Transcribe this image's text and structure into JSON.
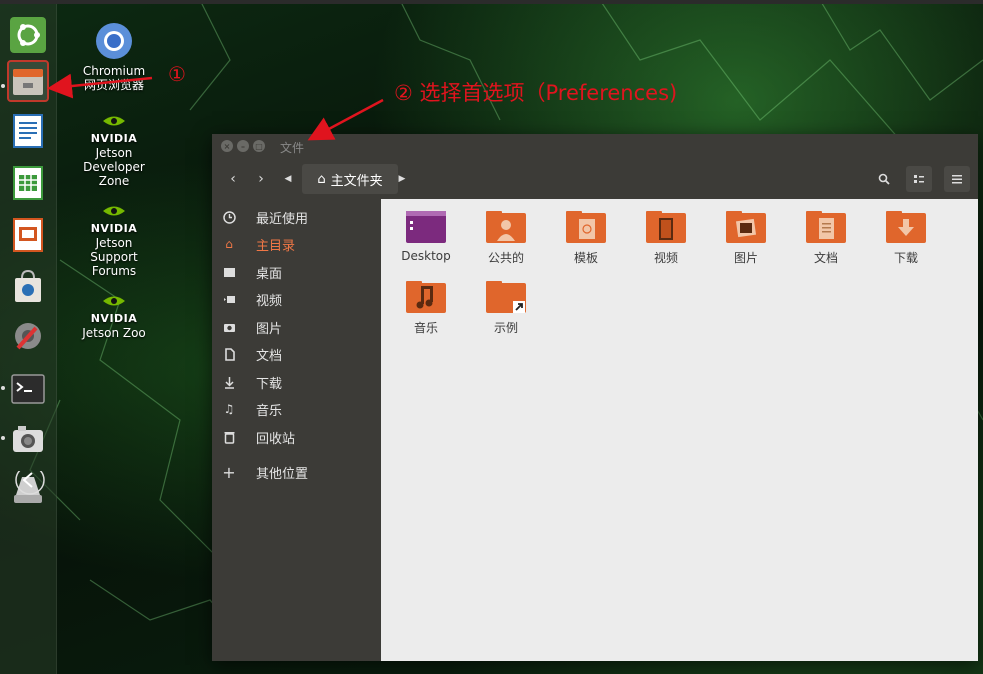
{
  "desktop": {
    "icons": [
      {
        "name": "Chromium",
        "line2": "网页浏览器"
      },
      {
        "brand": "NVIDIA",
        "lines": [
          "Jetson",
          "Developer",
          "Zone"
        ]
      },
      {
        "brand": "NVIDIA",
        "lines": [
          "Jetson",
          "Support",
          "Forums"
        ]
      },
      {
        "brand": "NVIDIA",
        "lines": [
          "Jetson Zoo"
        ]
      }
    ]
  },
  "annotations": {
    "step1": "①",
    "step2": "② 选择首选项（Preferences)"
  },
  "window": {
    "title": "文件",
    "path_label": "主文件夹"
  },
  "sidebar": {
    "items": [
      {
        "label": "最近使用",
        "icon": "clock-icon"
      },
      {
        "label": "主目录",
        "icon": "home-icon"
      },
      {
        "label": "桌面",
        "icon": "desktop-folder-icon"
      },
      {
        "label": "视频",
        "icon": "video-icon"
      },
      {
        "label": "图片",
        "icon": "camera-icon"
      },
      {
        "label": "文档",
        "icon": "document-icon"
      },
      {
        "label": "下载",
        "icon": "download-icon"
      },
      {
        "label": "音乐",
        "icon": "music-icon"
      },
      {
        "label": "回收站",
        "icon": "trash-icon"
      },
      {
        "label": "其他位置",
        "icon": "plus-icon"
      }
    ]
  },
  "files": [
    {
      "label": "Desktop",
      "icon": "desktop-folder-icon"
    },
    {
      "label": "公共的",
      "icon": "public-folder-icon"
    },
    {
      "label": "模板",
      "icon": "templates-folder-icon"
    },
    {
      "label": "视频",
      "icon": "videos-folder-icon"
    },
    {
      "label": "图片",
      "icon": "pictures-folder-icon"
    },
    {
      "label": "文档",
      "icon": "documents-folder-icon"
    },
    {
      "label": "下载",
      "icon": "downloads-folder-icon"
    },
    {
      "label": "音乐",
      "icon": "music-folder-icon"
    },
    {
      "label": "示例",
      "icon": "examples-folder-icon"
    }
  ],
  "colors": {
    "accent": "#f07746",
    "annotation": "#e0141e",
    "folder": "#e0662c"
  }
}
